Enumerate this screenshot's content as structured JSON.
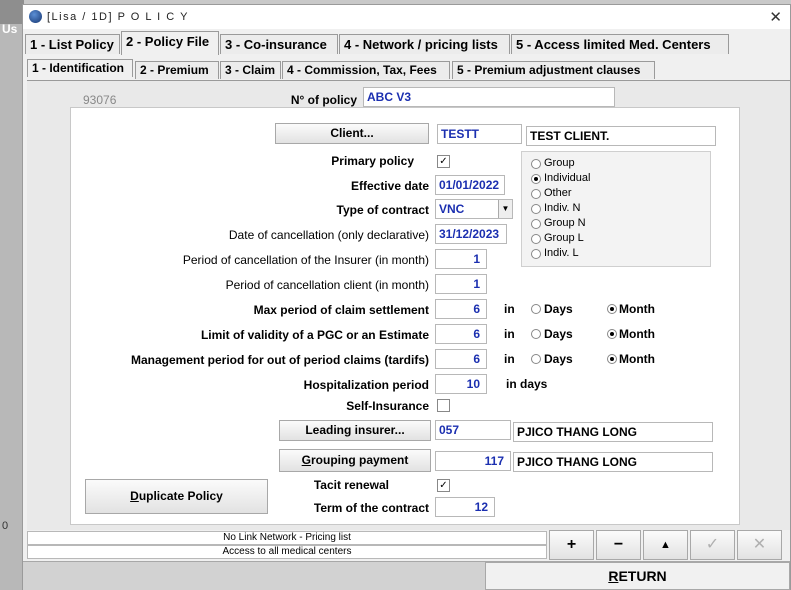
{
  "background_window": {
    "label": "Us",
    "bottom_label": "0"
  },
  "window": {
    "title": "[Lisa / 1D]  P O L I C Y",
    "close_glyph": "✕"
  },
  "main_tabs": [
    {
      "label": "1 - List Policy"
    },
    {
      "label": "2 - Policy File"
    },
    {
      "label": "3 - Co-insurance"
    },
    {
      "label": "4 - Network / pricing lists"
    },
    {
      "label": "5 - Access limited Med. Centers"
    }
  ],
  "sub_tabs": [
    {
      "label": "1 - Identification"
    },
    {
      "label": "2 - Premium"
    },
    {
      "label": "3 - Claim"
    },
    {
      "label": "4 - Commission, Tax, Fees"
    },
    {
      "label": "5 - Premium adjustment clauses"
    }
  ],
  "policy": {
    "code": "93076",
    "no_label": "N° of policy",
    "no_value": "ABC V3"
  },
  "client": {
    "button": "Client...",
    "code": "TESTT",
    "name": "TEST CLIENT."
  },
  "primary_policy": {
    "label": "Primary policy",
    "checked": true
  },
  "effective_date": {
    "label": "Effective date",
    "value": "01/01/2022"
  },
  "type_of_contract": {
    "label": "Type of contract",
    "value": "VNC"
  },
  "date_cancellation": {
    "label": "Date of cancellation (only declarative)",
    "value": "31/12/2023"
  },
  "period_insurer": {
    "label": "Period of cancellation of the Insurer (in month)",
    "value": "1"
  },
  "period_client": {
    "label": "Period of cancellation client (in month)",
    "value": "1"
  },
  "client_type_options": [
    {
      "label": "Group",
      "selected": false
    },
    {
      "label": "Individual",
      "selected": true
    },
    {
      "label": "Other",
      "selected": false
    },
    {
      "label": "Indiv. N",
      "selected": false
    },
    {
      "label": "Group N",
      "selected": false
    },
    {
      "label": "Group L",
      "selected": false
    },
    {
      "label": "Indiv. L",
      "selected": false
    }
  ],
  "max_claim": {
    "label": "Max period of claim settlement",
    "value": "6",
    "in": "in",
    "days": "Days",
    "month": "Month",
    "selected": "Month"
  },
  "limit_pgc": {
    "label": "Limit of validity of a PGC or an Estimate",
    "value": "6",
    "in": "in",
    "days": "Days",
    "month": "Month",
    "selected": "Month"
  },
  "mgmt_period": {
    "label": "Management period for out of period claims (tardifs)",
    "value": "6",
    "in": "in",
    "days": "Days",
    "month": "Month",
    "selected": "Month"
  },
  "hospitalization": {
    "label": "Hospitalization period",
    "value": "10",
    "unit": "in days"
  },
  "self_insurance": {
    "label": "Self-Insurance",
    "checked": false
  },
  "leading_insurer": {
    "button": "Leading insurer...",
    "code": "057",
    "name": "PJICO THANG LONG"
  },
  "grouping_payment": {
    "button": "Grouping payment",
    "code": "117",
    "name": "PJICO THANG LONG"
  },
  "duplicate_button": "Duplicate Policy",
  "tacit_renewal": {
    "label": "Tacit renewal",
    "checked": true
  },
  "term_contract": {
    "label": "Term of the contract",
    "value": "12"
  },
  "status": {
    "line1": "No Link Network - Pricing list",
    "line2": "Access to all medical centers"
  },
  "nav_buttons": [
    {
      "glyph": "+",
      "enabled": true
    },
    {
      "glyph": "−",
      "enabled": true
    },
    {
      "glyph": "▲",
      "enabled": true
    },
    {
      "glyph": "✓",
      "enabled": false
    },
    {
      "glyph": "✕",
      "enabled": false
    }
  ],
  "return_button": "RETURN"
}
